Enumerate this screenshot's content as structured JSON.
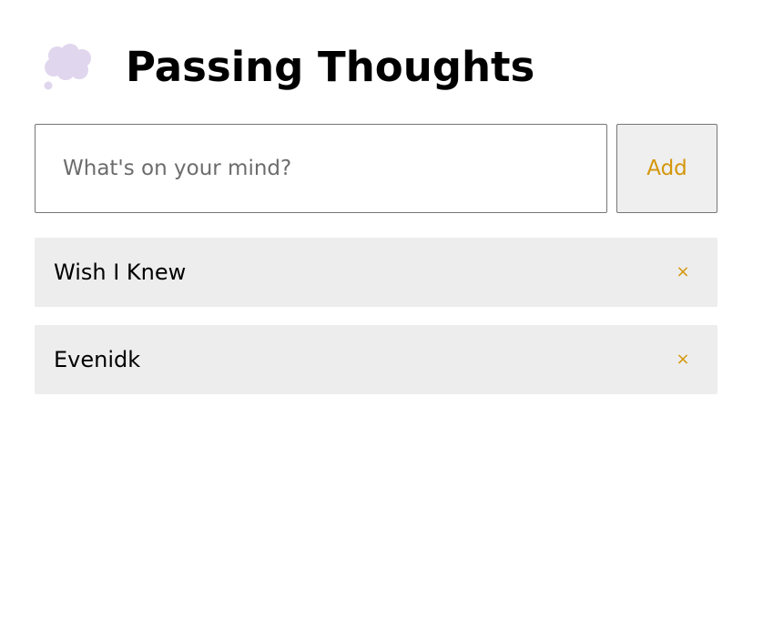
{
  "header": {
    "icon": "thought-cloud-icon",
    "title": "Passing Thoughts"
  },
  "form": {
    "input_value": "",
    "input_placeholder": "What's on your mind?",
    "add_label": "Add"
  },
  "thoughts": [
    {
      "text": "Wish I Knew",
      "delete_label": "×"
    },
    {
      "text": "Evenidk",
      "delete_label": "×"
    }
  ],
  "colors": {
    "accent": "#d4960a",
    "icon_fill": "#e0d6ed",
    "item_background": "#ededed",
    "button_background": "#efefef"
  }
}
